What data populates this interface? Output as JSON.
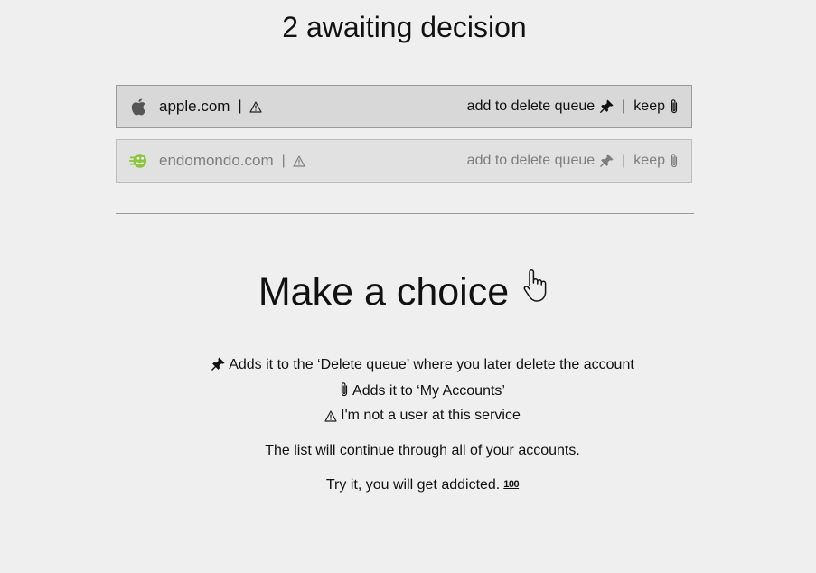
{
  "header": {
    "title": "2 awaiting decision"
  },
  "accounts": [
    {
      "domain": "apple.com",
      "separator": "|",
      "icon": "apple-logo",
      "delete_label": "add to delete queue",
      "action_separator": "|",
      "keep_label": "keep",
      "active": true
    },
    {
      "domain": "endomondo.com",
      "separator": "|",
      "icon": "endomondo-logo",
      "delete_label": "add to delete queue",
      "action_separator": "|",
      "keep_label": "keep",
      "active": false
    }
  ],
  "help": {
    "heading": "Make a choice",
    "heading_icon": "pointing-hand-icon",
    "pin_text": "Adds it to the ‘Delete queue’ where you later delete the account",
    "clip_text": "Adds it to ‘My Accounts’",
    "warn_text": "I'm not a user at this service",
    "continue_text": "The list will continue through all of your accounts.",
    "addicted_text": "Try it, you will get addicted.",
    "hundred_emoji": "100"
  },
  "colors": {
    "background": "#efefef",
    "row_active": "#d8d8d8",
    "row_inactive": "#e1e1e1",
    "endomondo_green": "#8cc63f"
  }
}
